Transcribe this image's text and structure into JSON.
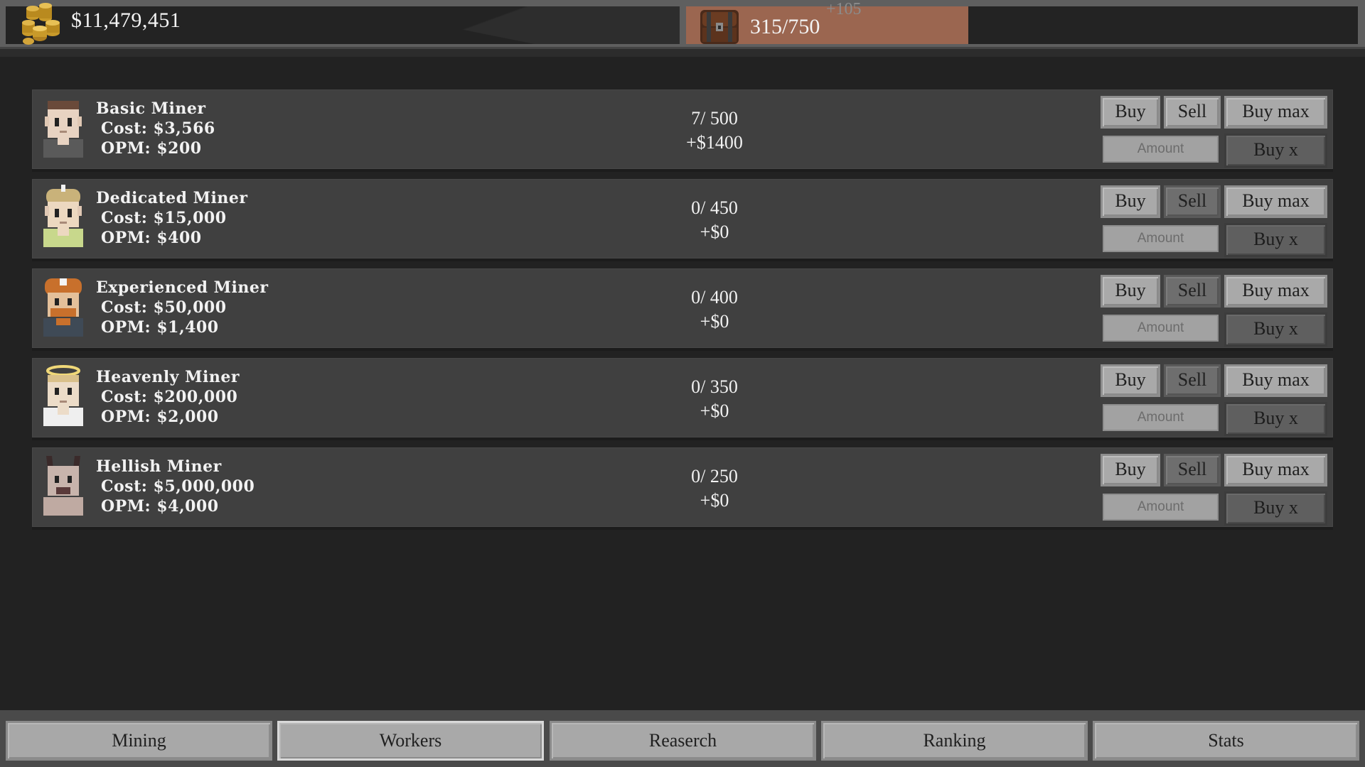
{
  "header": {
    "money": "$11,479,451",
    "storage": "315/750",
    "storage_gain": "+105",
    "colors": {
      "storage_panel": "#9b6650",
      "panel_bg": "#232323"
    },
    "icons": {
      "money": "gold-coins-icon",
      "storage": "treasure-chest-icon"
    }
  },
  "workers": [
    {
      "name": "Basic Miner",
      "cost": "Cost: $3,566",
      "opm": "OPM: $200",
      "count": "7/ 500",
      "income": "+$1400",
      "sell_enabled": true,
      "avatar": "basic-miner-avatar-icon"
    },
    {
      "name": "Dedicated Miner",
      "cost": "Cost: $15,000",
      "opm": "OPM: $400",
      "count": "0/ 450",
      "income": "+$0",
      "sell_enabled": false,
      "avatar": "dedicated-miner-avatar-icon"
    },
    {
      "name": "Experienced Miner",
      "cost": "Cost: $50,000",
      "opm": "OPM: $1,400",
      "count": "0/ 400",
      "income": "+$0",
      "sell_enabled": false,
      "avatar": "experienced-miner-avatar-icon"
    },
    {
      "name": "Heavenly Miner",
      "cost": "Cost: $200,000",
      "opm": "OPM: $2,000",
      "count": "0/ 350",
      "income": "+$0",
      "sell_enabled": false,
      "avatar": "heavenly-miner-avatar-icon"
    },
    {
      "name": "Hellish Miner",
      "cost": "Cost: $5,000,000",
      "opm": "OPM: $4,000",
      "count": "0/ 250",
      "income": "+$0",
      "sell_enabled": false,
      "avatar": "hellish-miner-avatar-icon"
    }
  ],
  "row_buttons": {
    "buy": "Buy",
    "sell": "Sell",
    "buy_max": "Buy max",
    "amount_placeholder": "Amount",
    "buy_x": "Buy x"
  },
  "nav": {
    "tabs": [
      "Mining",
      "Workers",
      "Reaserch",
      "Ranking",
      "Stats"
    ],
    "active": "Workers"
  }
}
